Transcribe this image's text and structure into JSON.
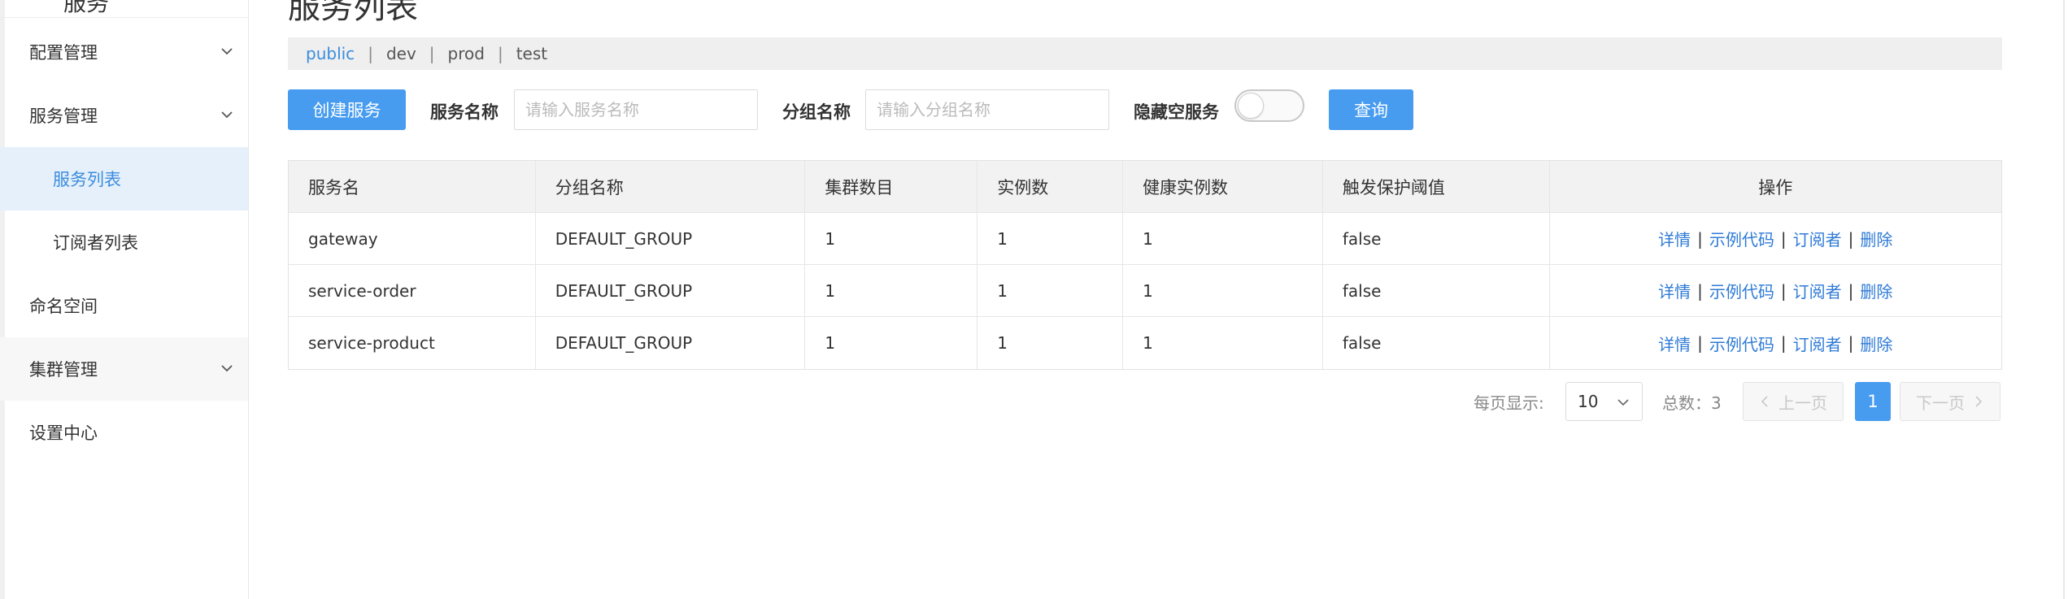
{
  "sidebar": {
    "top_fragment": "服务",
    "items": [
      {
        "label": "配置管理"
      },
      {
        "label": "服务管理"
      },
      {
        "label": "服务列表"
      },
      {
        "label": "订阅者列表"
      },
      {
        "label": "命名空间"
      },
      {
        "label": "集群管理"
      },
      {
        "label": "设置中心"
      }
    ]
  },
  "page": {
    "title": "服务列表"
  },
  "namespaces": [
    {
      "label": "public",
      "active": true
    },
    {
      "label": "dev"
    },
    {
      "label": "prod"
    },
    {
      "label": "test"
    }
  ],
  "namespace_separator": "|",
  "toolbar": {
    "create_label": "创建服务",
    "service_name_label": "服务名称",
    "service_name_placeholder": "请输入服务名称",
    "group_name_label": "分组名称",
    "group_name_placeholder": "请输入分组名称",
    "hide_empty_label": "隐藏空服务",
    "hide_empty_on": false,
    "query_label": "查询"
  },
  "table": {
    "columns": [
      "服务名",
      "分组名称",
      "集群数目",
      "实例数",
      "健康实例数",
      "触发保护阈值",
      "操作"
    ],
    "rows": [
      {
        "name": "gateway",
        "group": "DEFAULT_GROUP",
        "clusters": "1",
        "instances": "1",
        "healthy": "1",
        "threshold": "false"
      },
      {
        "name": "service-order",
        "group": "DEFAULT_GROUP",
        "clusters": "1",
        "instances": "1",
        "healthy": "1",
        "threshold": "false"
      },
      {
        "name": "service-product",
        "group": "DEFAULT_GROUP",
        "clusters": "1",
        "instances": "1",
        "healthy": "1",
        "threshold": "false"
      }
    ],
    "actions": {
      "detail": "详情",
      "sample": "示例代码",
      "subscriber": "订阅者",
      "delete": "删除",
      "separator": "|"
    }
  },
  "pagination": {
    "page_size_label": "每页显示:",
    "page_size": "10",
    "total_label": "总数：3",
    "prev_label": "上一页",
    "next_label": "下一页",
    "current_page": "1"
  },
  "colors": {
    "accent": "#479cf0",
    "link": "#2f7bd6",
    "active_nav_bg": "#e6f0fb"
  }
}
